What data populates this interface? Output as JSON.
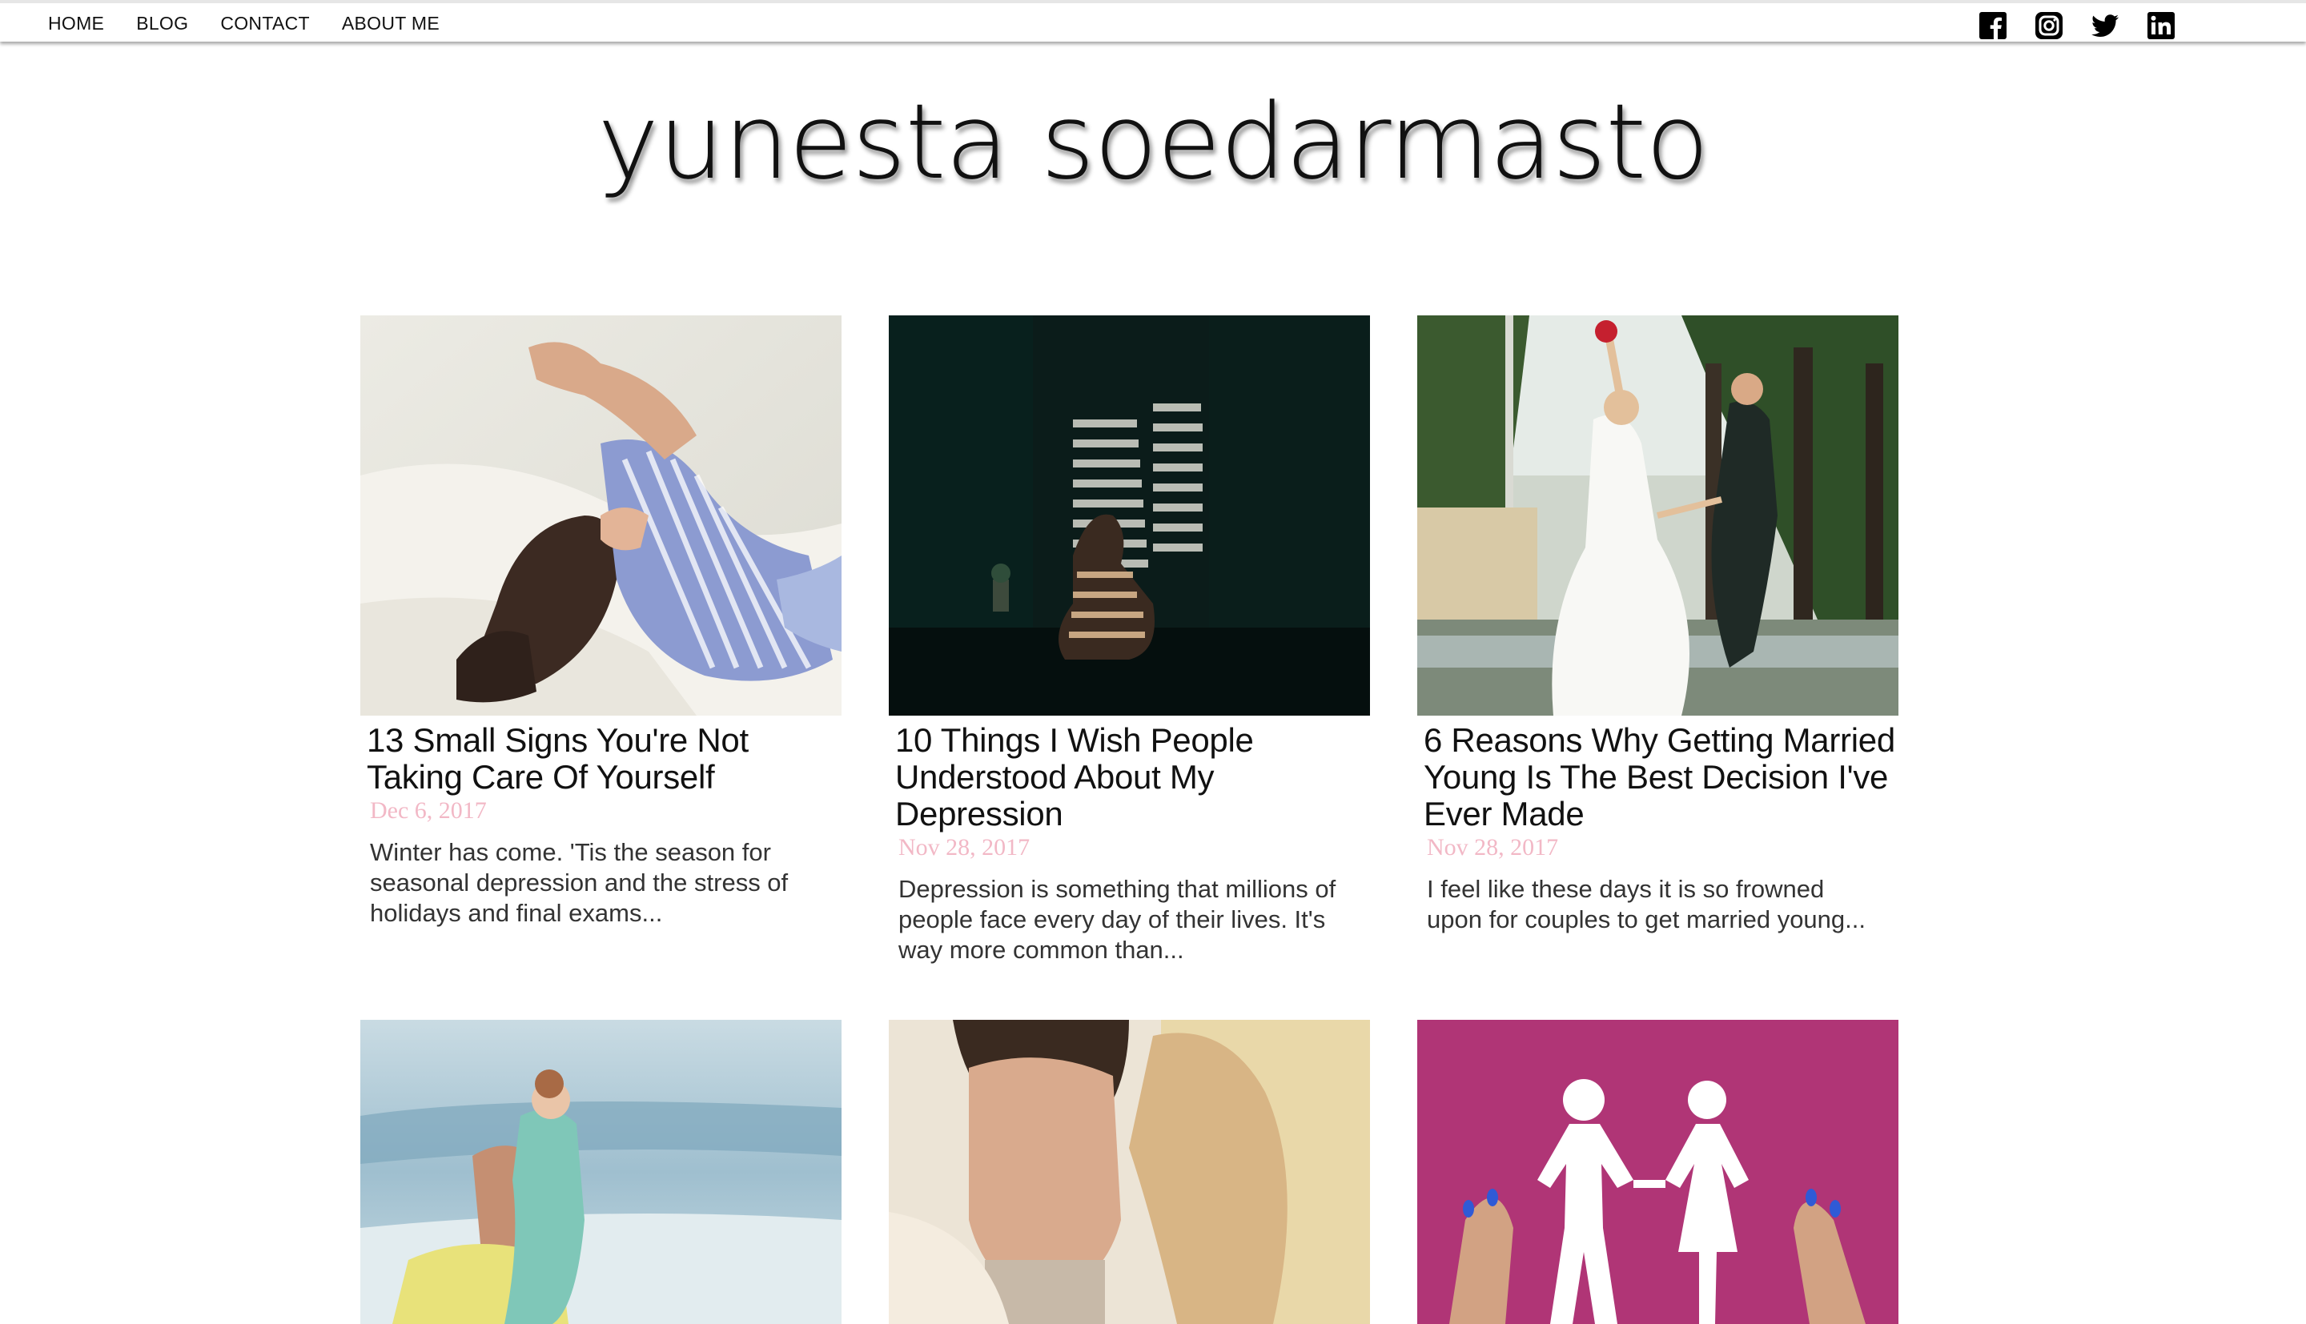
{
  "nav": {
    "items": [
      "HOME",
      "BLOG",
      "CONTACT",
      "ABOUT ME"
    ]
  },
  "social": {
    "icons": [
      "facebook-icon",
      "instagram-icon",
      "twitter-icon",
      "linkedin-icon"
    ]
  },
  "site": {
    "title": "yunesta soedarmasto"
  },
  "colors": {
    "date": "#f2b8c6",
    "text": "#111111",
    "pink_tile": "#b03576"
  },
  "posts": [
    {
      "title": "13 Small Signs You're Not Taking Care Of Yourself",
      "date": "Dec 6, 2017",
      "excerpt": "Winter has come. 'Tis the season for seasonal depression and the stress of holidays and final exams..."
    },
    {
      "title": "10 Things I Wish People Understood About My Depression",
      "date": "Nov 28, 2017",
      "excerpt": "Depression is something that millions of people face every day of their lives. It's way more common than..."
    },
    {
      "title": "6 Reasons Why Getting Married Young Is The Best Decision I've Ever Made",
      "date": "Nov 28, 2017",
      "excerpt": "I feel like these days it is so frowned upon for couples to get married young..."
    }
  ]
}
